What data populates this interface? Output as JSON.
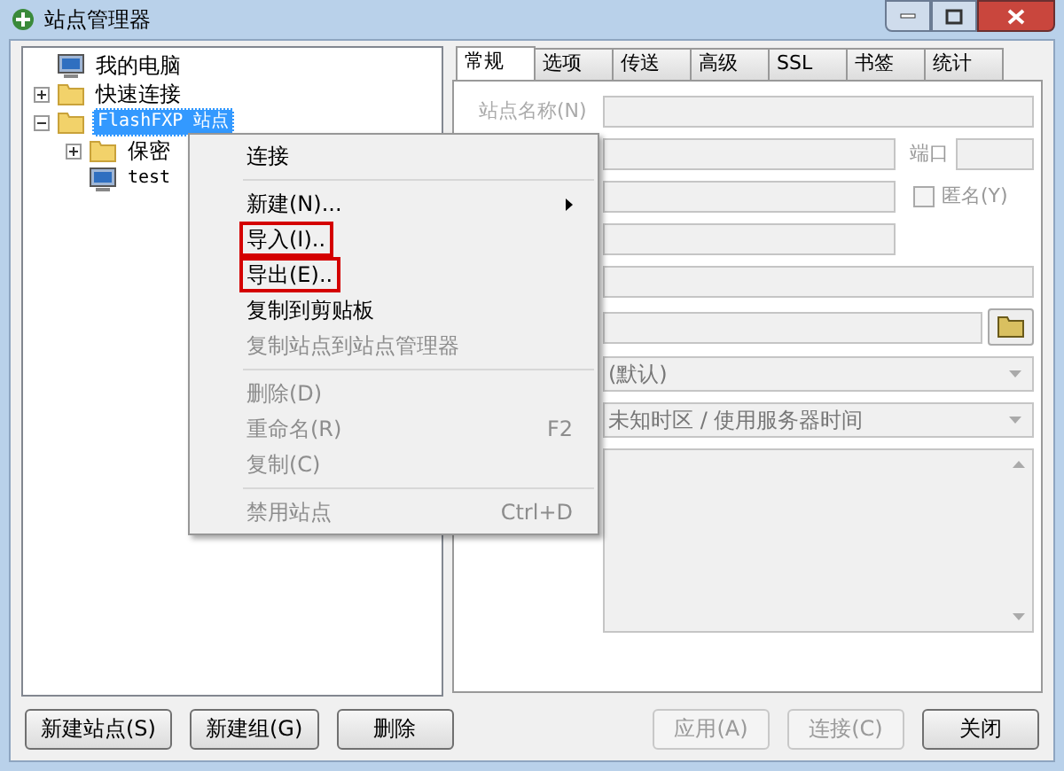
{
  "window": {
    "title": "站点管理器"
  },
  "tree": [
    {
      "label": "我的电脑",
      "kind": "computer",
      "selected": false
    },
    {
      "label": "快速连接",
      "kind": "folder",
      "selected": false,
      "expanded": false
    },
    {
      "label": "FlashFXP 站点",
      "kind": "folder",
      "selected": true,
      "expanded": true,
      "children": [
        {
          "label": "保密",
          "kind": "folder",
          "selected": false,
          "expanded": false
        },
        {
          "label": "test",
          "kind": "computer",
          "selected": false
        }
      ]
    }
  ],
  "tabs": [
    {
      "label": "常规",
      "selected": true
    },
    {
      "label": "选项",
      "selected": false
    },
    {
      "label": "传送",
      "selected": false
    },
    {
      "label": "高级",
      "selected": false
    },
    {
      "label": "SSL",
      "selected": false
    },
    {
      "label": "书签",
      "selected": false
    },
    {
      "label": "统计",
      "selected": false
    }
  ],
  "form": {
    "site_name_label": "站点名称(N)",
    "port_label": "端口",
    "anonymous": {
      "label": "匿名(Y)",
      "checked": false
    },
    "dropdown_1": "(默认)",
    "dropdown_2": "未知时区 / 使用服务器时间"
  },
  "context_menu": [
    {
      "kind": "item",
      "label": "连接",
      "disabled": false,
      "boxed": false
    },
    {
      "kind": "separator"
    },
    {
      "kind": "item",
      "label": "新建(N)...",
      "disabled": false,
      "submenu": true,
      "boxed": false
    },
    {
      "kind": "item",
      "label": "导入(I)..",
      "disabled": false,
      "boxed": true
    },
    {
      "kind": "item",
      "label": "导出(E)..",
      "disabled": false,
      "boxed": true
    },
    {
      "kind": "item",
      "label": "复制到剪贴板",
      "disabled": false,
      "boxed": false
    },
    {
      "kind": "item",
      "label": "复制站点到站点管理器",
      "disabled": true,
      "boxed": false
    },
    {
      "kind": "separator"
    },
    {
      "kind": "item",
      "label": "删除(D)",
      "disabled": true,
      "boxed": false
    },
    {
      "kind": "item",
      "label": "重命名(R)",
      "disabled": true,
      "shortcut": "F2",
      "boxed": false
    },
    {
      "kind": "item",
      "label": "复制(C)",
      "disabled": true,
      "boxed": false
    },
    {
      "kind": "separator"
    },
    {
      "kind": "item",
      "label": "禁用站点",
      "disabled": true,
      "shortcut": "Ctrl+D",
      "boxed": false
    }
  ],
  "buttons_left": [
    {
      "label": "新建站点(S)",
      "disabled": false
    },
    {
      "label": "新建组(G)",
      "disabled": false
    },
    {
      "label": "删除",
      "disabled": false
    }
  ],
  "buttons_right": [
    {
      "label": "应用(A)",
      "disabled": true
    },
    {
      "label": "连接(C)",
      "disabled": true
    },
    {
      "label": "关闭",
      "disabled": false
    }
  ]
}
